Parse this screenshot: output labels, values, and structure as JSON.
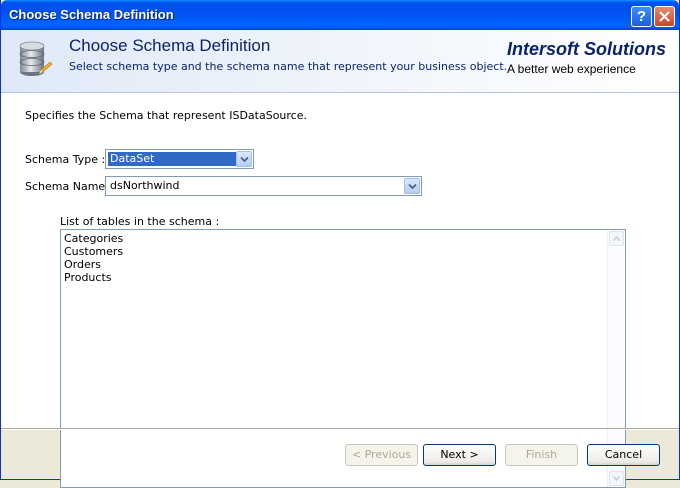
{
  "window": {
    "title": "Choose Schema Definition",
    "help_glyph": "?"
  },
  "header": {
    "title": "Choose Schema Definition",
    "subtitle": "Select schema type and the schema name that represent your business object.",
    "brand_name": "Intersoft Solutions",
    "brand_tagline": "A better web experience",
    "icon": "database-icon"
  },
  "form": {
    "description": "Specifies the Schema that represent ISDataSource.",
    "schema_type_label": "Schema Type :",
    "schema_type_value": "DataSet",
    "schema_name_label": "Schema Name :",
    "schema_name_value": "dsNorthwind",
    "tables_label": "List of tables in the schema :",
    "tables": [
      "Categories",
      "Customers",
      "Orders",
      "Products"
    ]
  },
  "footer": {
    "previous_label": "< Previous",
    "next_label": "Next >",
    "finish_label": "Finish",
    "cancel_label": "Cancel"
  },
  "colors": {
    "titlebar": "#0053ee",
    "selection": "#316ac5",
    "header_text": "#0a246a",
    "dialog_face": "#ece9d8"
  }
}
